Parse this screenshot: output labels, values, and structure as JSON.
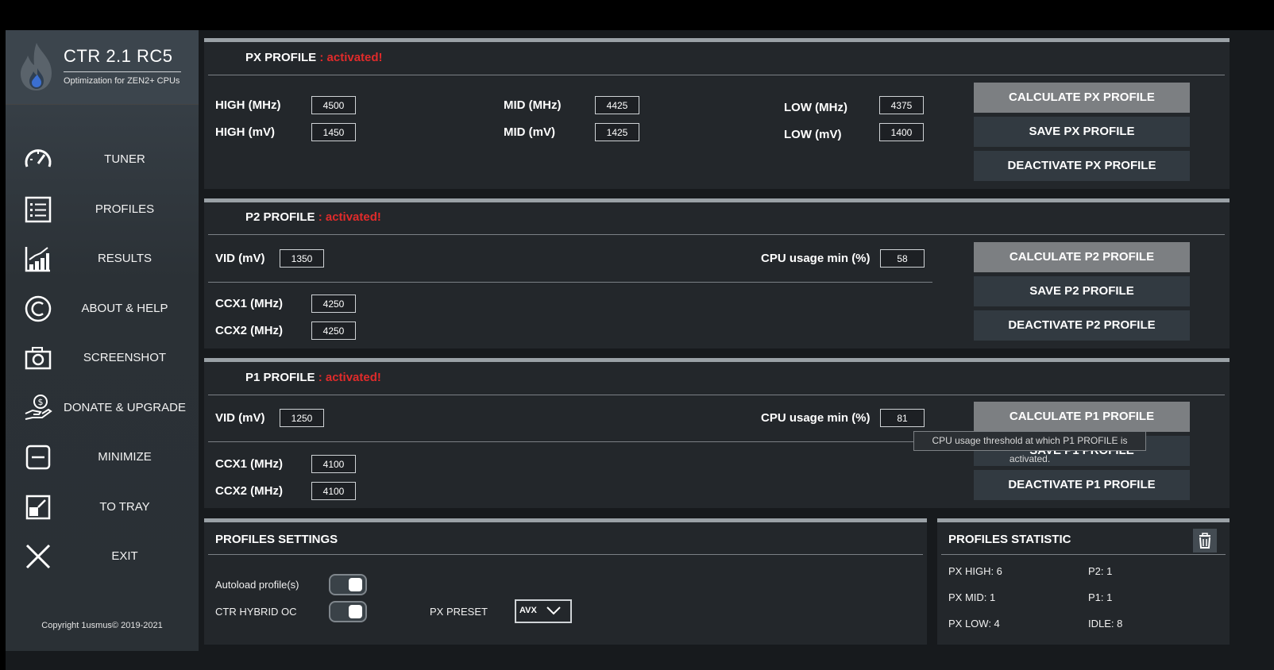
{
  "app": {
    "title": "CTR 2.1 RC5",
    "subtitle": "Optimization for ZEN2+ CPUs",
    "copyright": "Copyright 1usmus© 2019-2021"
  },
  "nav": [
    {
      "label": "TUNER",
      "icon": "speedometer-icon"
    },
    {
      "label": "PROFILES",
      "icon": "list-icon"
    },
    {
      "label": "RESULTS",
      "icon": "bar-chart-icon"
    },
    {
      "label": "ABOUT & HELP",
      "icon": "copyright-icon"
    },
    {
      "label": "SCREENSHOT",
      "icon": "camera-icon"
    },
    {
      "label": "DONATE & UPGRADE",
      "icon": "donate-hand-icon"
    },
    {
      "label": "MINIMIZE",
      "icon": "minimize-icon"
    },
    {
      "label": "TO TRAY",
      "icon": "tray-icon"
    },
    {
      "label": "EXIT",
      "icon": "close-icon"
    }
  ],
  "px": {
    "title": "PX PROFILE",
    "status": " : activated!",
    "high_mhz_label": "HIGH (MHz)",
    "high_mhz": "4500",
    "high_mv_label": "HIGH  (mV)",
    "high_mv": "1450",
    "mid_mhz_label": "MID (MHz)",
    "mid_mhz": "4425",
    "mid_mv_label": "MID (mV)",
    "mid_mv": "1425",
    "low_mhz_label": "LOW (MHz)",
    "low_mhz": "4375",
    "low_mv_label": "LOW (mV)",
    "low_mv": "1400",
    "calc": "CALCULATE PX PROFILE",
    "save": "SAVE PX PROFILE",
    "deact": "DEACTIVATE PX PROFILE"
  },
  "p2": {
    "title": "P2 PROFILE",
    "status": " : activated!",
    "vid_label": "VID (mV)",
    "vid": "1350",
    "cpu_label": "CPU usage min (%)",
    "cpu": "58",
    "ccx1_label": "CCX1 (MHz)",
    "ccx1": "4250",
    "ccx2_label": "CCX2 (MHz)",
    "ccx2": "4250",
    "calc": "CALCULATE P2 PROFILE",
    "save": "SAVE P2 PROFILE",
    "deact": "DEACTIVATE P2 PROFILE"
  },
  "p1": {
    "title": "P1 PROFILE",
    "status": " : activated!",
    "vid_label": "VID (mV)",
    "vid": "1250",
    "cpu_label": "CPU usage min (%)",
    "cpu": "81",
    "ccx1_label": "CCX1 (MHz)",
    "ccx1": "4100",
    "ccx2_label": "CCX2 (MHz)",
    "ccx2": "4100",
    "calc": "CALCULATE P1 PROFILE",
    "save": "SAVE P1 PROFILE",
    "deact": "DEACTIVATE P1 PROFILE",
    "tooltip": "CPU usage threshold at which P1 PROFILE is activated."
  },
  "settings": {
    "title": "PROFILES SETTINGS",
    "autoload_label": "Autoload profile(s)",
    "hybrid_label": "CTR HYBRID OC",
    "preset_label": "PX PRESET",
    "preset_value": "AVX"
  },
  "stats": {
    "title": "PROFILES STATISTIC",
    "px_high": "PX HIGH: 6",
    "px_mid": "PX MID: 1",
    "px_low": "PX LOW: 4",
    "p2": "P2: 1",
    "p1": "P1: 1",
    "idle": "IDLE: 8"
  },
  "colors": {
    "accent_active": "#e02b2b",
    "sidebar": "#2e353b",
    "panel": "#23272b",
    "button": "#323a41",
    "button_primary": "#7c7f82"
  }
}
